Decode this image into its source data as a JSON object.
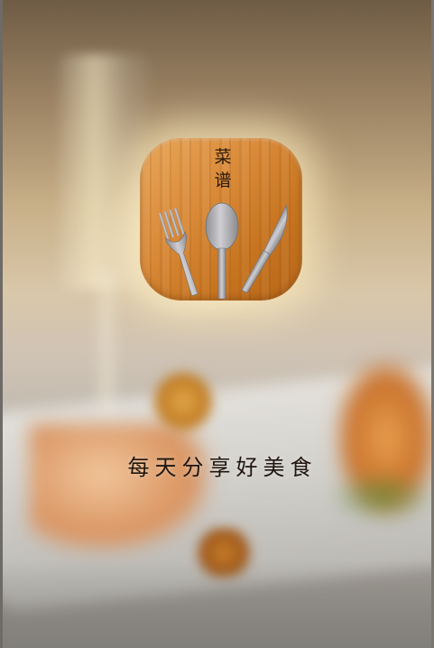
{
  "app_icon": {
    "title_line1": "菜",
    "title_line2": "谱",
    "icons": [
      "fork-icon",
      "spoon-icon",
      "knife-icon"
    ],
    "wood_color": "#d98a38"
  },
  "slogan": "每天分享好美食",
  "colors": {
    "text_dark": "#1f160e",
    "glow": "#fff4d6"
  }
}
